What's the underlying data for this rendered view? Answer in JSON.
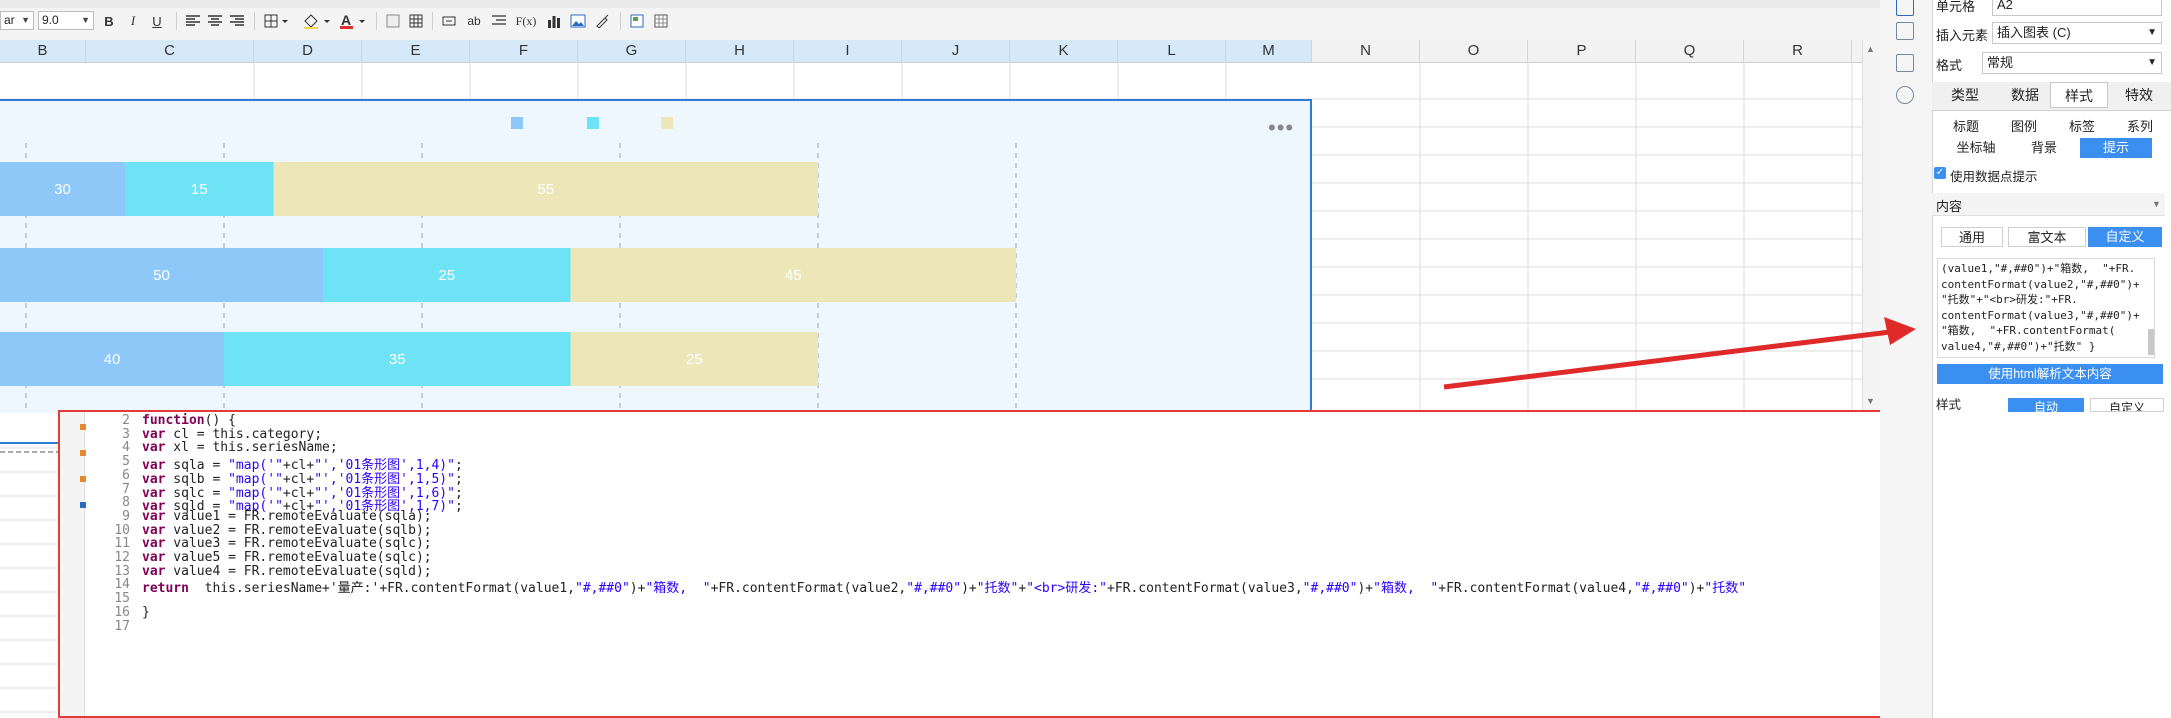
{
  "toolbar": {
    "font_name": "ar",
    "font_size": "9.0",
    "bold": "B",
    "italic": "I",
    "underline": "U",
    "text_abbrev": "ab",
    "formula": "F(x)"
  },
  "columns": [
    "B",
    "C",
    "D",
    "E",
    "F",
    "G",
    "H",
    "I",
    "J",
    "K",
    "L",
    "M",
    "N",
    "O",
    "P",
    "Q",
    "R"
  ],
  "chart": {
    "rows": [
      {
        "values": [
          30,
          15,
          55
        ]
      },
      {
        "values": [
          50,
          25,
          45
        ]
      },
      {
        "values": [
          40,
          35,
          25
        ]
      }
    ],
    "series_colors": [
      "#8dc8f8",
      "#6fe3f6",
      "#ece6b8"
    ]
  },
  "chart_data": {
    "type": "bar",
    "orientation": "horizontal",
    "stacked": true,
    "categories": [
      "",
      "",
      ""
    ],
    "series": [
      {
        "values": [
          30,
          50,
          40
        ]
      },
      {
        "values": [
          15,
          25,
          35
        ]
      },
      {
        "values": [
          55,
          45,
          25
        ]
      }
    ],
    "grid": true
  },
  "editor": {
    "lines": [
      {
        "n": "2",
        "code": "function() {"
      },
      {
        "n": "3",
        "code": "var cl = this.category;"
      },
      {
        "n": "4",
        "code": "var xl = this.seriesName;"
      },
      {
        "n": "5",
        "code": "var sqla = \"map('\"+cl+\"','01条形图',1,4)\";"
      },
      {
        "n": "6",
        "code": "var sqlb = \"map('\"+cl+\"','01条形图',1,5)\";"
      },
      {
        "n": "7",
        "code": "var sqlc = \"map('\"+cl+\"','01条形图',1,6)\";"
      },
      {
        "n": "8",
        "code": "var sqld = \"map('\"+cl+\"','01条形图',1,7)\";"
      },
      {
        "n": "9",
        "code": "var value1 = FR.remoteEvaluate(sqla);"
      },
      {
        "n": "10",
        "code": "var value2 = FR.remoteEvaluate(sqlb);"
      },
      {
        "n": "11",
        "code": "var value3 = FR.remoteEvaluate(sqlc);"
      },
      {
        "n": "12",
        "code": "var value5 = FR.remoteEvaluate(sqlc);"
      },
      {
        "n": "13",
        "code": "var value4 = FR.remoteEvaluate(sqld);"
      },
      {
        "n": "14",
        "code": "return  this.seriesName+'量产:'+FR.contentFormat(value1,\"#,##0\")+\"箱数,  \"+FR.contentFormat(value2,\"#,##0\")+\"托数\"+\"<br>研发:\"+FR.contentFormat(value3,\"#,##0\")+\"箱数,  \"+FR.contentFormat(value4,\"#,##0\")+\"托数\""
      },
      {
        "n": "15",
        "code": ""
      },
      {
        "n": "16",
        "code": "}"
      },
      {
        "n": "17",
        "code": ""
      }
    ]
  },
  "right_panel": {
    "cell_label": "单元格",
    "cell_value": "A2",
    "insert_label": "插入元素",
    "insert_value": "插入图表 (C)",
    "style_label": "格式",
    "style_value": "常规",
    "tabs": [
      "类型",
      "数据",
      "样式",
      "特效"
    ],
    "sub_tabs_row1": [
      "标题",
      "图例",
      "标签",
      "系列"
    ],
    "sub_tabs_row2": [
      "坐标轴",
      "背景",
      "提示"
    ],
    "checkbox_label": "使用数据点提示",
    "content_label": "内容",
    "content_tabs": [
      "通用",
      "富文本",
      "自定义"
    ],
    "code_preview": "(value1,\"#,##0\")+\"箱数,  \"+FR.\ncontentFormat(value2,\"#,##0\")+\n\"托数\"+\"<br>研发:\"+FR.\ncontentFormat(value3,\"#,##0\")+\n\"箱数,  \"+FR.contentFormat(\nvalue4,\"#,##0\")+\"托数\" }",
    "html_button": "使用html解析文本内容",
    "style2_label": "样式",
    "style2_tabs": [
      "自动",
      "自定义"
    ]
  }
}
